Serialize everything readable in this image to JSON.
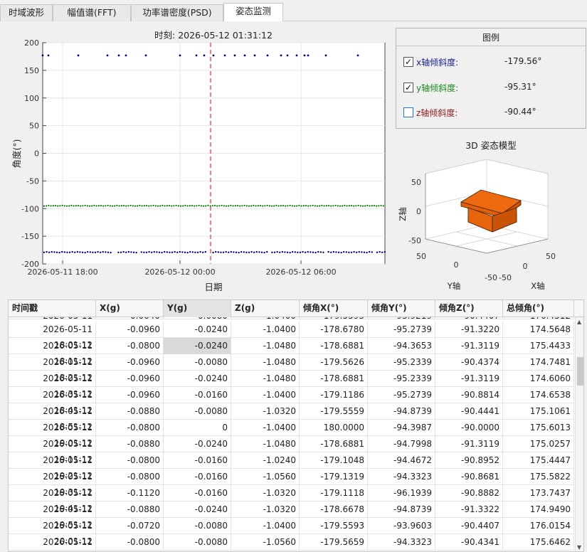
{
  "tabs": [
    {
      "label": "时域波形"
    },
    {
      "label": "幅值谱(FFT)"
    },
    {
      "label": "功率谱密度(PSD)"
    },
    {
      "label": "姿态监测"
    }
  ],
  "chart_data": {
    "type": "scatter",
    "title": "时刻: 2026-05-12 01:31:12",
    "xlabel": "日期",
    "ylabel": "角度(°)",
    "ylim": [
      -200,
      200
    ],
    "yticks": [
      -200,
      -150,
      -100,
      -50,
      0,
      50,
      100,
      150,
      200
    ],
    "x_range": [
      "2026-05-11 17:22",
      "2026-05-12 10:00"
    ],
    "xticks": [
      "2026-05-11 18:00",
      "2026-05-12 00:00",
      "2026-05-12 06:00"
    ],
    "cursor_time": "2026-05-12 01:31:12",
    "grid": true,
    "series": [
      {
        "color": "#000080",
        "values": [
          180,
          180,
          180,
          180,
          180,
          180,
          180,
          180,
          180,
          180,
          180,
          180,
          180,
          180,
          180,
          180,
          180,
          180,
          180,
          180,
          180,
          180,
          180,
          180
        ]
      },
      {
        "color": "#008000",
        "values": [
          -95.3,
          -95.2,
          -94.4,
          -95.2,
          -94.8,
          -94.7,
          -95.3,
          -94.9,
          -94.4,
          -95.0
        ]
      },
      {
        "color": "#000080",
        "values": [
          -179.6,
          -178.7,
          -179.6,
          -178.7,
          -179.1,
          -179.6,
          -180.0,
          -178.7,
          -179.1,
          -179.6
        ]
      }
    ]
  },
  "legend": {
    "title": "图例",
    "items": [
      {
        "label": "x轴倾斜度:",
        "value": "-179.56°",
        "checked": "✓",
        "color": "#1a1a8c"
      },
      {
        "label": "y轴倾斜度:",
        "value": "-95.31°",
        "checked": "✓",
        "color": "#1a8a1a"
      },
      {
        "label": "z轴倾斜度:",
        "value": "-90.44°",
        "checked": "",
        "color": "#8c1a1a"
      }
    ]
  },
  "model3d": {
    "title": "3D 姿态模型",
    "zlabel": "Z轴",
    "ylabel": "Y轴",
    "xlabel": "X轴",
    "z_ticks": [
      "50",
      "0",
      "-50"
    ],
    "y_ticks": [
      "50",
      "0",
      "-50"
    ],
    "x_ticks": [
      "50",
      "0",
      "-50"
    ],
    "box_color": "#e8660c"
  },
  "table": {
    "columns": [
      "时间戳",
      "X(g)",
      "Y(g)",
      "Z(g)",
      "倾角X(°)",
      "倾角Y(°)",
      "倾角Z(°)",
      "总倾角(°)"
    ],
    "partial_row": [
      "2026-05-11 17:51:12",
      "-0.0640",
      "-0.0080",
      "-1.0400",
      "-179.5593",
      "-93.9219",
      "-90.4407",
      "176.4512"
    ],
    "rows": [
      [
        "2026-05-11 18:01:12",
        "-0.0960",
        "-0.0240",
        "-1.0400",
        "-178.6780",
        "-95.2739",
        "-91.3220",
        "174.5648"
      ],
      [
        "2026-05-11 18:11:12",
        "-0.0800",
        "-0.0240",
        "-1.0480",
        "-178.6881",
        "-94.3653",
        "-91.3119",
        "175.4433"
      ],
      [
        "2026-05-11 18:21:12",
        "-0.0960",
        "-0.0080",
        "-1.0480",
        "-179.5626",
        "-95.2339",
        "-90.4374",
        "174.7481"
      ],
      [
        "2026-05-11 18:31:12",
        "-0.0960",
        "-0.0240",
        "-1.0480",
        "-178.6881",
        "-95.2339",
        "-91.3119",
        "174.6060"
      ],
      [
        "2026-05-11 18:41:12",
        "-0.0960",
        "-0.0160",
        "-1.0400",
        "-179.1186",
        "-95.2739",
        "-90.8814",
        "174.6538"
      ],
      [
        "2026-05-11 18:51:12",
        "-0.0880",
        "-0.0080",
        "-1.0320",
        "-179.5559",
        "-94.8739",
        "-90.4441",
        "175.1061"
      ],
      [
        "2026-05-11 19:01:12",
        "-0.0800",
        "0",
        "-1.0400",
        "180.0000",
        "-94.3987",
        "-90.0000",
        "175.6013"
      ],
      [
        "2026-05-11 19:11:12",
        "-0.0880",
        "-0.0240",
        "-1.0480",
        "-178.6881",
        "-94.7998",
        "-91.3119",
        "175.0257"
      ],
      [
        "2026-05-11 19:21:12",
        "-0.0800",
        "-0.0160",
        "-1.0240",
        "-179.1048",
        "-94.4672",
        "-90.8952",
        "175.4447"
      ],
      [
        "2026-05-11 19:31:12",
        "-0.0800",
        "-0.0160",
        "-1.0560",
        "-179.1319",
        "-94.3323",
        "-90.8681",
        "175.5822"
      ],
      [
        "2026-05-11 19:41:12",
        "-0.1120",
        "-0.0160",
        "-1.0320",
        "-179.1118",
        "-96.1939",
        "-90.8882",
        "173.7437"
      ],
      [
        "2026-05-11 19:51:12",
        "-0.0880",
        "-0.0240",
        "-1.0320",
        "-178.6678",
        "-94.8739",
        "-91.3322",
        "174.9490"
      ],
      [
        "2026-05-11 20:01:12",
        "-0.0720",
        "-0.0080",
        "-1.0400",
        "-179.5593",
        "-93.9603",
        "-90.4407",
        "176.0154"
      ],
      [
        "2026-05-11 20:11:12",
        "-0.0800",
        "-0.0080",
        "-1.0560",
        "-179.5659",
        "-94.3323",
        "-90.4341",
        "175.6462"
      ]
    ]
  },
  "colors": {
    "cursor": "#e83030",
    "grid": "#e6e6e6",
    "x_series": "#000080",
    "y_series": "#008000"
  }
}
